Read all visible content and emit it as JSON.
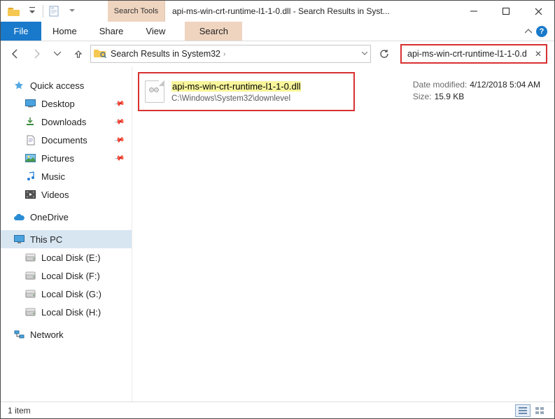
{
  "title": "api-ms-win-crt-runtime-l1-1-0.dll - Search Results in Syst...",
  "search_tools_label": "Search Tools",
  "ribbon": {
    "file": "File",
    "home": "Home",
    "share": "Share",
    "view": "View",
    "search": "Search"
  },
  "address": {
    "crumb1": "Search Results in System32",
    "chev": "›"
  },
  "searchbox": {
    "value": "api-ms-win-crt-runtime-l1-1-0.d"
  },
  "nav": {
    "quick_access": "Quick access",
    "desktop": "Desktop",
    "downloads": "Downloads",
    "documents": "Documents",
    "pictures": "Pictures",
    "music": "Music",
    "videos": "Videos",
    "onedrive": "OneDrive",
    "this_pc": "This PC",
    "disk_e": "Local Disk (E:)",
    "disk_f": "Local Disk (F:)",
    "disk_g": "Local Disk (G:)",
    "disk_h": "Local Disk (H:)",
    "network": "Network"
  },
  "result": {
    "filename": "api-ms-win-crt-runtime-l1-1-0.dll",
    "path": "C:\\Windows\\System32\\downlevel"
  },
  "details": {
    "date_label": "Date modified:",
    "date_value": "4/12/2018 5:04 AM",
    "size_label": "Size:",
    "size_value": "15.9 KB"
  },
  "status": {
    "count": "1 item"
  }
}
